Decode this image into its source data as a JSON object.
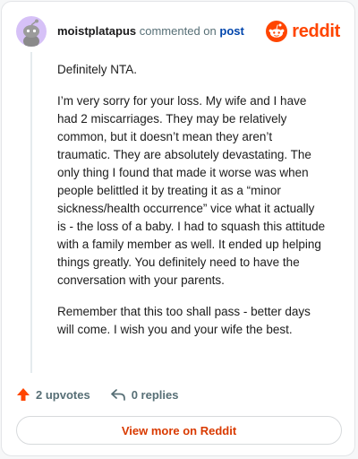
{
  "header": {
    "username": "moistplatapus",
    "action_text": "commented on",
    "post_link": "post",
    "logo_text": "reddit"
  },
  "comment": {
    "paragraphs": [
      "Definitely NTA.",
      "I’m very sorry for your loss. My wife and I have had 2 miscarriages. They may be relatively common, but it doesn’t mean they aren’t traumatic. They are absolutely devastating. The only thing I found that made it worse was when people belittled it by treating it as a “minor sickness/health occurrence” vice what it actually is - the loss of a baby. I had to squash this attitude with a family member as well. It ended up helping things greatly. You definitely need to have the conversation with your parents.",
      "Remember that this too shall pass - better days will come. I wish you and your wife the best."
    ]
  },
  "actions": {
    "upvotes_label": "2 upvotes",
    "replies_label": "0 replies"
  },
  "footer": {
    "view_button_label": "View more on Reddit"
  },
  "colors": {
    "brand": "#ff4500",
    "link": "#0045ac",
    "avatar_bg": "#d6c1f7"
  },
  "icons": [
    "avatar-snoo-icon",
    "reddit-logo-icon",
    "upvote-arrow-icon",
    "reply-arrow-icon"
  ]
}
